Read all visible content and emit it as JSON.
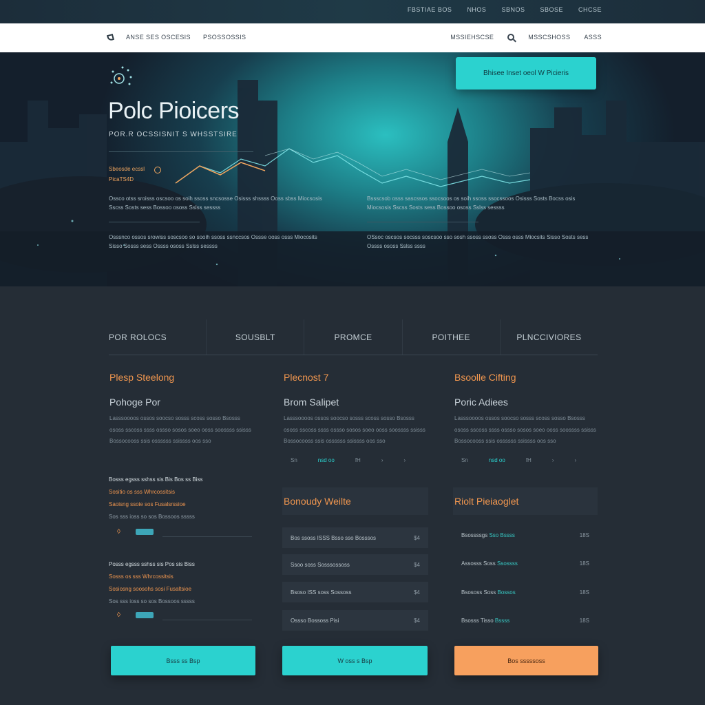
{
  "top_links": [
    "FBSTIAE BOS",
    "NHOS",
    "SBNOS",
    "SBOSE",
    "CHCSE"
  ],
  "nav": {
    "left": [
      "ANSE SES OSCESIS",
      "PSOSSOSSIS"
    ],
    "right": [
      "MSSIEHSCSE",
      "MSSCSHOSS",
      "ASSS"
    ]
  },
  "hero": {
    "cta": "Bhisee Inset oeol W Picieris",
    "title": "Polc Pioicers",
    "subtitle": "POR.R OCSSISNIT S WHSSTSIRE",
    "metric_label_1": "Sbeosde ecssl",
    "metric_label_2": "PicaTS4D",
    "text_left_1": "Ossco otss sroisss oscsoo os soih ssoss sncsosse Osisss shssss Ooss sbss Miocsosis Sscss Sosts sess Bossoo ososs Sslss sessss",
    "text_left_2": "Osssnco ossos srowiss soscsoo so sooih ssoss ssnccsos Ossse ooss osss Miocosits Sisso Sosss sess Ossss ososs Sslss sessss",
    "text_right_1": "Bssscsob osss sascssos ssocsoos os soih ssoss ssocssoos Osisss Sosts Bocss osis Miocsosis Sscss Sosts sess Bossoo ososs Sslss sessss",
    "text_right_2": "OSsoc oscsos socsss soscsoo sso sosh ssoss ssoss Osss osss Miocsits Sisso Sosts sess Ossss ososs Sslss ssss"
  },
  "tabs": [
    "POR ROLOCS",
    "SOUSBLT",
    "PROMCE",
    "POITHEE",
    "PLNCCIVIORES"
  ],
  "columns": [
    {
      "head": "Plesp Steelong",
      "sub": "Pohoge Por",
      "text": "Lasssoooos ossos soocso sosss scoss sosso Bsosss ososs sscoss ssss ossso sosos soeo ooss soossss ssisss Bossocooss ssis ossssss ssissss oos sso"
    },
    {
      "head": "Plecnost 7",
      "sub": "Brom Salipet",
      "text": "Lasssoooos ossos soocso sosss scoss sosso Bsosss ososs sscoss ssss ossso sosos soeo ooss soossss ssisss Bossocooss ssis ossssss ssissss oos sso",
      "pager": [
        "Sn",
        "nsd oo",
        "fH",
        "›",
        "›"
      ]
    },
    {
      "head": "Bsoolle Cifting",
      "sub": "Poric Adiees",
      "text": "Lasssoooos ossos soocso sosss scoss sosso Bsosss ososs sscoss ssss ossso sosos soeo ooss soossss ssisss Bossocooss ssis ossssss ssissss oos sso",
      "pager": [
        "Sn",
        "nsd oo",
        "fH",
        "›",
        "›"
      ]
    }
  ],
  "quotes": [
    {
      "w": "Bosss egsss sshss sis Bis Bos ss Biss",
      "o1": "Sositio os sss Whrcossitsis",
      "o2": "Saoisng ssoie sos Fusalsrssioe",
      "g": "Sos sss ioss so sos Bossoos sssss"
    },
    {
      "w": "Posss egsss sshss sis Pos sis Biss",
      "o1": "Sosss os sss Whrcossitsis",
      "o2": "Sosiosng soosohs sosi Fusaltsioe",
      "g": "Sos sss ioss so sos Bossoos sssss"
    }
  ],
  "panel_mid": {
    "head": "Bonoudy Weilte",
    "rows": [
      {
        "label": "Bos ssoss ISSS Bsso sso Bosssos",
        "num": "$4"
      },
      {
        "label": "Ssoo soss Sosssossoss",
        "num": "$4"
      },
      {
        "label": "Bsoso ISS soss Sossoss",
        "num": "$4"
      },
      {
        "label": "Ossso Bossoss Pisi",
        "num": "$4"
      }
    ]
  },
  "panel_right": {
    "head": "Riolt Pieiaoglet",
    "rows": [
      {
        "label": "Bsossssgs",
        "teal": "Sso Bssss",
        "num": "18S"
      },
      {
        "label": "Assosss Soss",
        "teal": "Ssossss",
        "num": "18S"
      },
      {
        "label": "Bsososs Soss",
        "teal": "Bossos",
        "num": "18S"
      },
      {
        "label": "Bsosss Tisso",
        "teal": "Bssss",
        "num": "18S"
      }
    ]
  },
  "buttons": [
    "Bsss ss Bsp",
    "W oss s Bsp",
    "Bos sssssoss"
  ],
  "colors": {
    "accent_teal": "#2bd2cf",
    "accent_orange": "#f0964f",
    "background": "#252d36"
  }
}
